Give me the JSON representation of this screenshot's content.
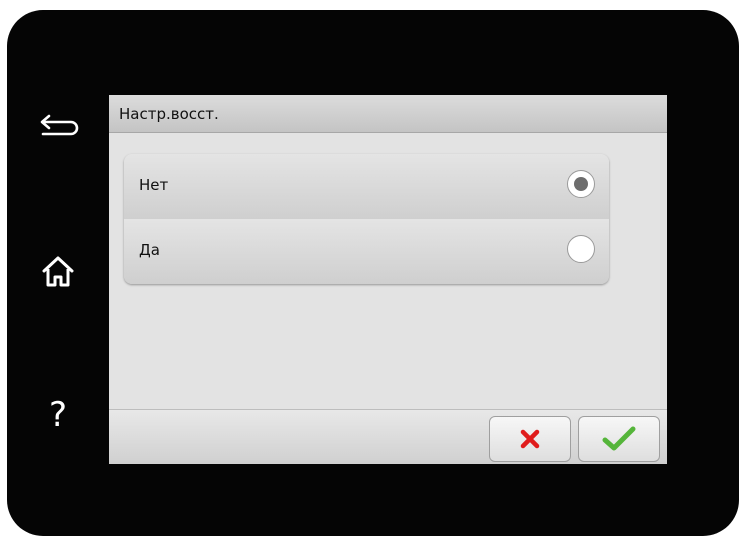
{
  "window": {
    "title": "Настр.восст."
  },
  "side_nav": {
    "back_icon": "back-arrow-icon",
    "home_icon": "home-icon",
    "help_label": "?"
  },
  "options": [
    {
      "label": "Нет",
      "selected": true
    },
    {
      "label": "Да",
      "selected": false
    }
  ],
  "actions": {
    "cancel_icon": "x-icon",
    "confirm_icon": "checkmark-icon"
  },
  "colors": {
    "cancel": "#e01c1c",
    "confirm": "#55b53a",
    "bezel": "#050505"
  }
}
